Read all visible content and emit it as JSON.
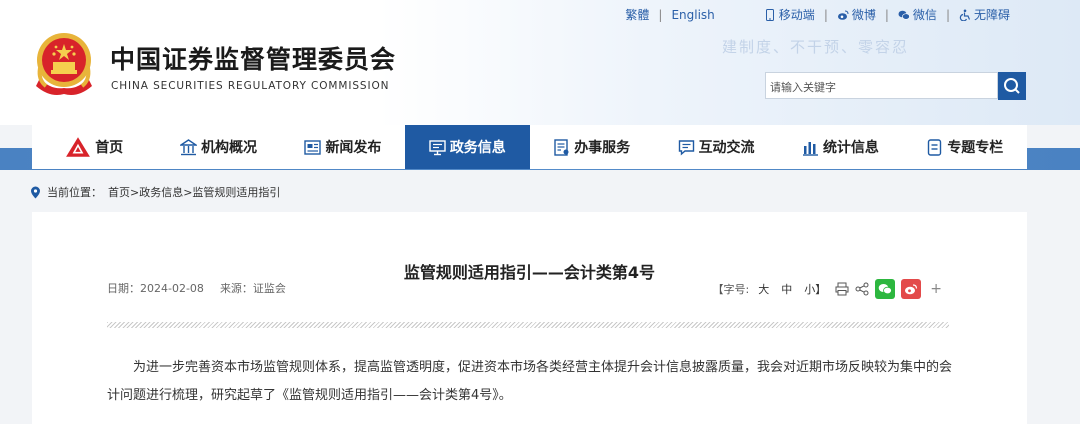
{
  "top_links": {
    "traditional": "繁體",
    "english": "English",
    "mobile": "移动端",
    "weibo": "微博",
    "wechat": "微信",
    "accessibility": "无障碍"
  },
  "slogan": "建制度、不干预、零容忍",
  "site": {
    "title_cn": "中国证券监督管理委员会",
    "title_en": "CHINA SECURITIES REGULATORY COMMISSION"
  },
  "search": {
    "placeholder": "请输入关键字"
  },
  "nav": [
    {
      "label": "首页",
      "icon": "home-logo-icon"
    },
    {
      "label": "机构概况",
      "icon": "institution-icon"
    },
    {
      "label": "新闻发布",
      "icon": "news-icon"
    },
    {
      "label": "政务信息",
      "icon": "government-info-icon",
      "active": true
    },
    {
      "label": "办事服务",
      "icon": "service-icon"
    },
    {
      "label": "互动交流",
      "icon": "interaction-icon"
    },
    {
      "label": "统计信息",
      "icon": "statistics-icon"
    },
    {
      "label": "专题专栏",
      "icon": "special-topic-icon"
    }
  ],
  "breadcrumb": {
    "prefix": "当前位置：",
    "path": "首页>政务信息>监管规则适用指引"
  },
  "article": {
    "title": "监管规则适用指引——会计类第4号",
    "date_label": "日期：2024-02-08",
    "source_label": "来源：证监会",
    "font_size_label": "【字号:",
    "size_large": "大",
    "size_medium": "中",
    "size_small": "小】",
    "plus": "+",
    "paragraph": "为进一步完善资本市场监管规则体系，提高监管透明度，促进资本市场各类经营主体提升会计信息披露质量，我会对近期市场反映较为集中的会计问题进行梳理，研究起草了《监管规则适用指引——会计类第4号》。"
  },
  "colors": {
    "brand_blue": "#1f5aa3",
    "band_blue": "#4a82c2",
    "wechat_green": "#2db73f",
    "weibo_red": "#e34a4a"
  }
}
